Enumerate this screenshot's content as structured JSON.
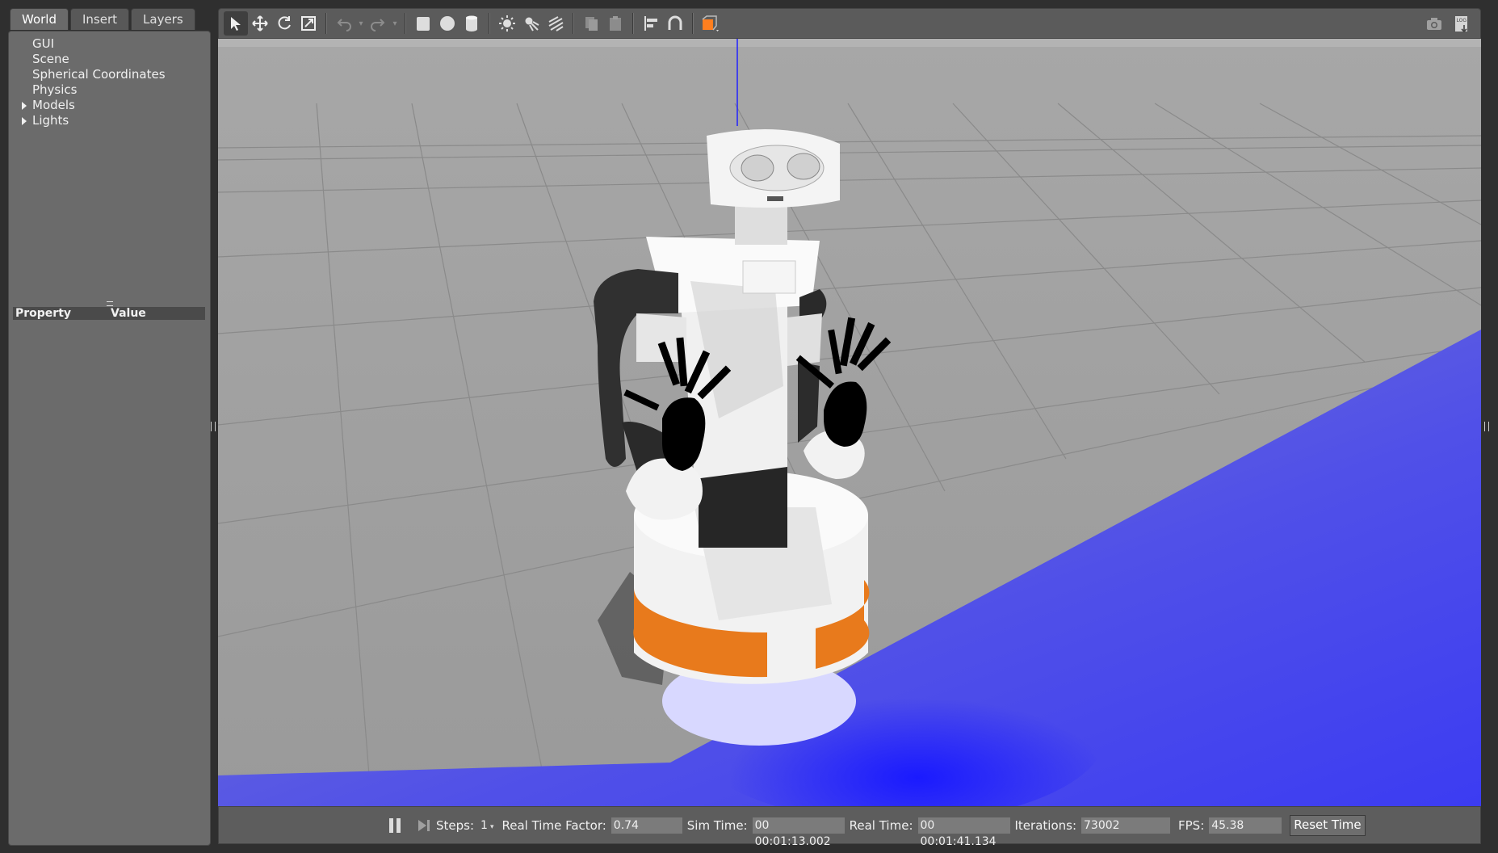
{
  "tabs": [
    "World",
    "Insert",
    "Layers"
  ],
  "tree": {
    "items": [
      {
        "label": "GUI",
        "expandable": false
      },
      {
        "label": "Scene",
        "expandable": false
      },
      {
        "label": "Spherical Coordinates",
        "expandable": false
      },
      {
        "label": "Physics",
        "expandable": false
      },
      {
        "label": "Models",
        "expandable": true
      },
      {
        "label": "Lights",
        "expandable": true
      }
    ]
  },
  "properties": {
    "col_property": "Property",
    "col_value": "Value"
  },
  "toolbar": {
    "tools": [
      "select-arrow-icon",
      "translate-icon",
      "rotate-icon",
      "scale-icon",
      "undo-icon",
      "redo-icon",
      "box-icon",
      "sphere-icon",
      "cylinder-icon",
      "point-light-icon",
      "spot-light-icon",
      "directional-light-icon",
      "copy-icon",
      "paste-icon",
      "align-icon",
      "snap-icon",
      "view-angle-icon"
    ],
    "right": [
      "screenshot-icon",
      "log-icon"
    ],
    "accent": "#ff7f1f"
  },
  "bottom": {
    "steps_label": "Steps:",
    "steps_value": "1",
    "rtf_label": "Real Time Factor:",
    "rtf_value": "0.74",
    "sim_time_label": "Sim Time:",
    "sim_time_value": "00 00:01:13.002",
    "real_time_label": "Real Time:",
    "real_time_value": "00 00:01:41.134",
    "iterations_label": "Iterations:",
    "iterations_value": "73002",
    "fps_label": "FPS:",
    "fps_value": "45.38",
    "reset_label": "Reset Time"
  },
  "scene": {
    "laser_color": "#2e2ef5",
    "robot_accent": "#e8741a"
  }
}
